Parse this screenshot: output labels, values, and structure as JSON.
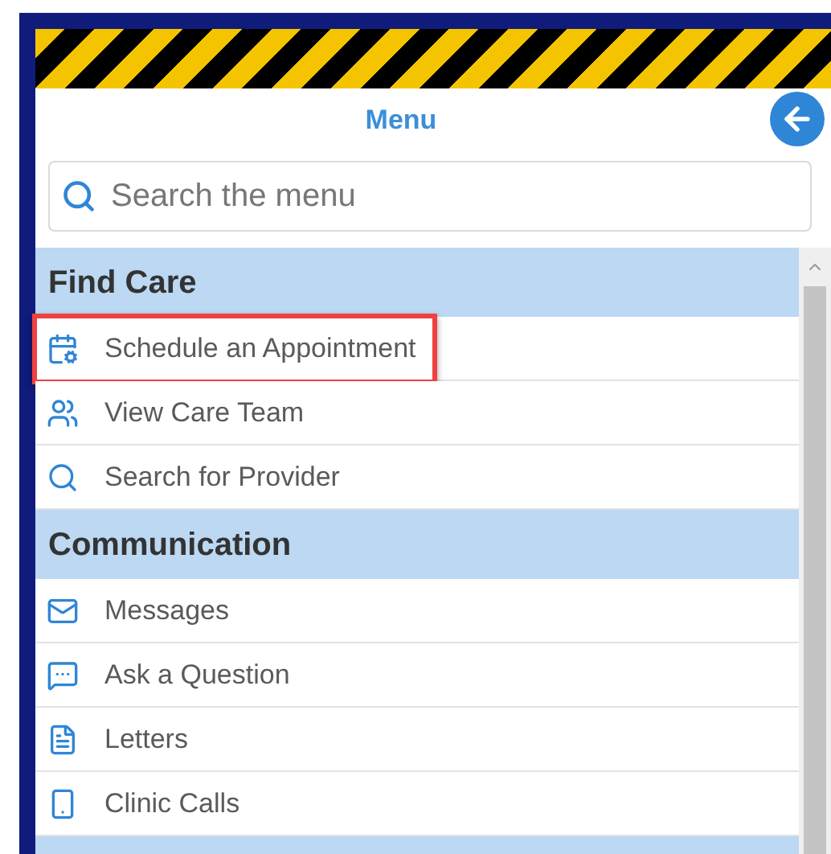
{
  "header": {
    "title": "Menu"
  },
  "search": {
    "placeholder": "Search the menu"
  },
  "sections": [
    {
      "title": "Find Care",
      "items": [
        {
          "label": "Schedule an Appointment",
          "highlighted": true
        },
        {
          "label": "View Care Team",
          "highlighted": false
        },
        {
          "label": "Search for Provider",
          "highlighted": false
        }
      ]
    },
    {
      "title": "Communication",
      "items": [
        {
          "label": "Messages",
          "highlighted": false
        },
        {
          "label": "Ask a Question",
          "highlighted": false
        },
        {
          "label": "Letters",
          "highlighted": false
        },
        {
          "label": "Clinic Calls",
          "highlighted": false
        }
      ]
    }
  ]
}
